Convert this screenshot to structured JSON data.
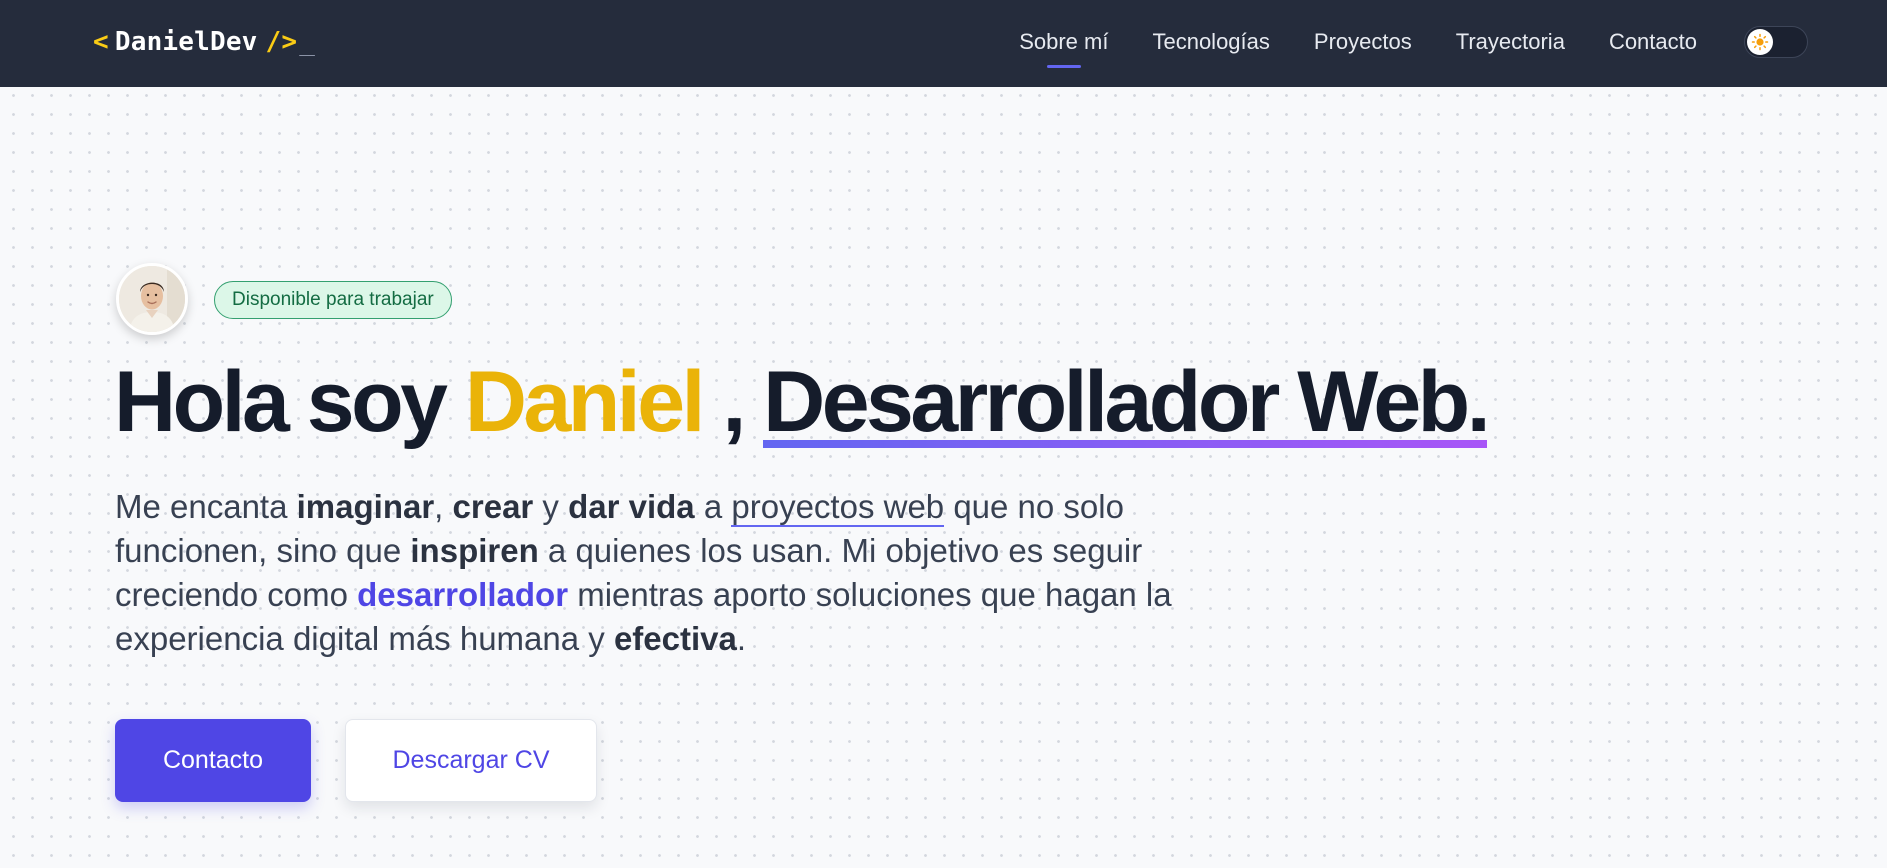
{
  "logo": {
    "open": "<",
    "name": "DanielDev",
    "close": "/>",
    "cursor": "_"
  },
  "nav": {
    "items": [
      {
        "label": "Sobre mí",
        "active": true
      },
      {
        "label": "Tecnologías",
        "active": false
      },
      {
        "label": "Proyectos",
        "active": false
      },
      {
        "label": "Trayectoria",
        "active": false
      },
      {
        "label": "Contacto",
        "active": false
      }
    ],
    "theme_toggle_icon": "sun-icon"
  },
  "hero": {
    "status_badge": "Disponible para trabajar",
    "avatar_icon": "avatar-photo",
    "headline": {
      "greeting": "Hola soy ",
      "name": "Daniel",
      "separator": " , ",
      "role": "Desarrollador Web."
    },
    "intro": {
      "p1": "Me encanta ",
      "b1": "imaginar",
      "p2": ", ",
      "b2": "crear",
      "p3": " y ",
      "b3": "dar vida",
      "p4": " a ",
      "u1": "proyectos web",
      "p5": " que no solo funcionen, sino que ",
      "b4": "inspiren",
      "p6": " a quienes los usan. Mi objetivo es seguir creciendo como ",
      "accent": "desarrollador",
      "p7": " mientras aporto soluciones que hagan la experiencia digital más humana y ",
      "b5": "efectiva",
      "p8": "."
    },
    "buttons": {
      "contact": "Contacto",
      "download_cv": "Descargar CV"
    }
  },
  "colors": {
    "nav_bg": "#252c3c",
    "accent": "#4f46e5",
    "name_yellow": "#eab308",
    "badge_green": "#146c43"
  }
}
